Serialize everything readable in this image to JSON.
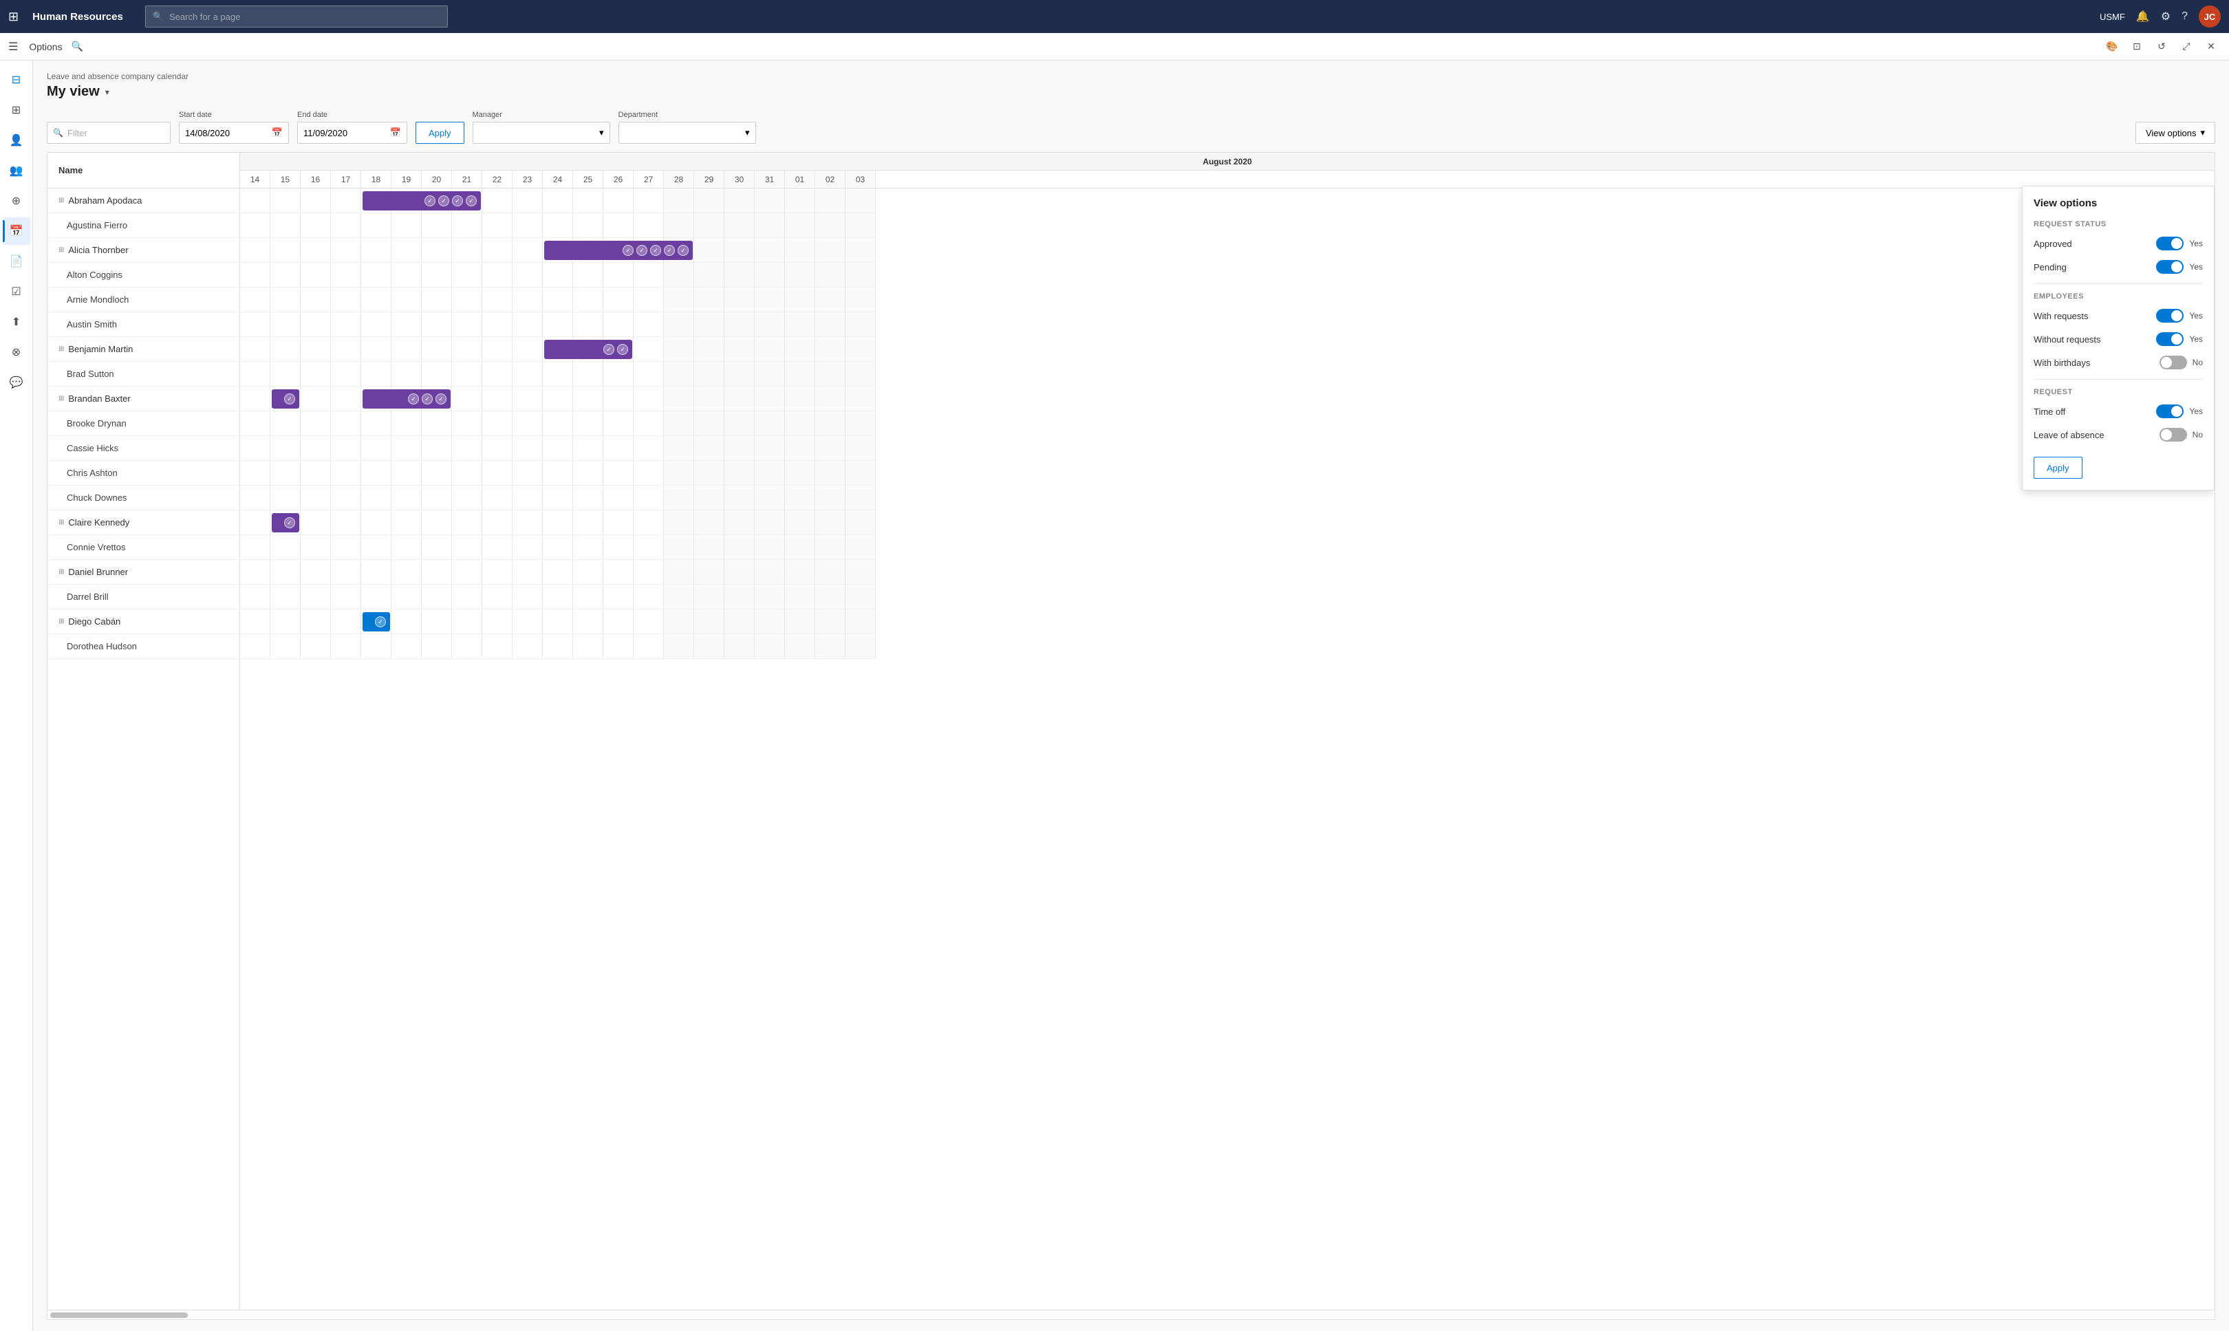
{
  "topNav": {
    "appTitle": "Human Resources",
    "searchPlaceholder": "Search for a page",
    "username": "USMF",
    "avatarText": "JC"
  },
  "secondNav": {
    "optionsLabel": "Options"
  },
  "page": {
    "subtitle": "Leave and absence company calendar",
    "title": "My view",
    "filterLabel": "Filter",
    "startDateLabel": "Start date",
    "startDateValue": "14/08/2020",
    "endDateLabel": "End date",
    "endDateValue": "11/09/2020",
    "managerLabel": "Manager",
    "departmentLabel": "Department",
    "applyLabel": "Apply",
    "viewOptionsLabel": "View options"
  },
  "calendar": {
    "nameHeader": "Name",
    "monthLabel": "August 2020",
    "days": [
      "14",
      "15",
      "16",
      "17",
      "18",
      "19",
      "20",
      "21",
      "22",
      "23",
      "24",
      "25",
      "26",
      "27",
      "28",
      "29",
      "30",
      "31",
      "01",
      "02",
      "03"
    ],
    "rows": [
      {
        "name": "Abraham Apodaca",
        "group": true
      },
      {
        "name": "Agustina Fierro",
        "group": false
      },
      {
        "name": "Alicia Thornber",
        "group": true
      },
      {
        "name": "Alton Coggins",
        "group": false
      },
      {
        "name": "Arnie Mondloch",
        "group": false
      },
      {
        "name": "Austin Smith",
        "group": false
      },
      {
        "name": "Benjamin Martin",
        "group": true
      },
      {
        "name": "Brad Sutton",
        "group": false
      },
      {
        "name": "Brandan Baxter",
        "group": true
      },
      {
        "name": "Brooke Drynan",
        "group": false
      },
      {
        "name": "Cassie Hicks",
        "group": false
      },
      {
        "name": "Chris Ashton",
        "group": false
      },
      {
        "name": "Chuck Downes",
        "group": false
      },
      {
        "name": "Claire Kennedy",
        "group": true
      },
      {
        "name": "Connie Vrettos",
        "group": false
      },
      {
        "name": "Daniel Brunner",
        "group": true
      },
      {
        "name": "Darrel Brill",
        "group": false
      },
      {
        "name": "Diego Cabán",
        "group": true
      },
      {
        "name": "Dorothea Hudson",
        "group": false
      }
    ]
  },
  "viewOptions": {
    "title": "View options",
    "requestStatusLabel": "REQUEST STATUS",
    "approvedLabel": "Approved",
    "approvedOn": true,
    "approvedValue": "Yes",
    "pendingLabel": "Pending",
    "pendingOn": true,
    "pendingValue": "Yes",
    "employeesLabel": "EMPLOYEES",
    "withRequestsLabel": "With requests",
    "withRequestsOn": true,
    "withRequestsValue": "Yes",
    "withoutRequestsLabel": "Without requests",
    "withoutRequestsOn": true,
    "withoutRequestsValue": "Yes",
    "withBirthdaysLabel": "With birthdays",
    "withBirthdaysOn": false,
    "withBirthdaysValue": "No",
    "requestLabel": "REQUEST",
    "timeOffLabel": "Time off",
    "timeOffOn": true,
    "timeOffValue": "Yes",
    "leaveOfAbsenceLabel": "Leave of absence",
    "leaveOfAbsenceOn": false,
    "leaveOfAbsenceValue": "No",
    "applyLabel": "Apply"
  },
  "sidebarItems": [
    {
      "icon": "⊞",
      "name": "dashboard",
      "active": false
    },
    {
      "icon": "👤",
      "name": "employees",
      "active": false
    },
    {
      "icon": "📋",
      "name": "leave",
      "active": false
    },
    {
      "icon": "👥",
      "name": "teams",
      "active": false
    },
    {
      "icon": "📅",
      "name": "calendar",
      "active": true
    },
    {
      "icon": "📄",
      "name": "reports",
      "active": false
    },
    {
      "icon": "⚙",
      "name": "settings",
      "active": false
    },
    {
      "icon": "📊",
      "name": "analytics",
      "active": false
    },
    {
      "icon": "🔔",
      "name": "notifications",
      "active": false
    },
    {
      "icon": "💬",
      "name": "messages",
      "active": false
    }
  ]
}
